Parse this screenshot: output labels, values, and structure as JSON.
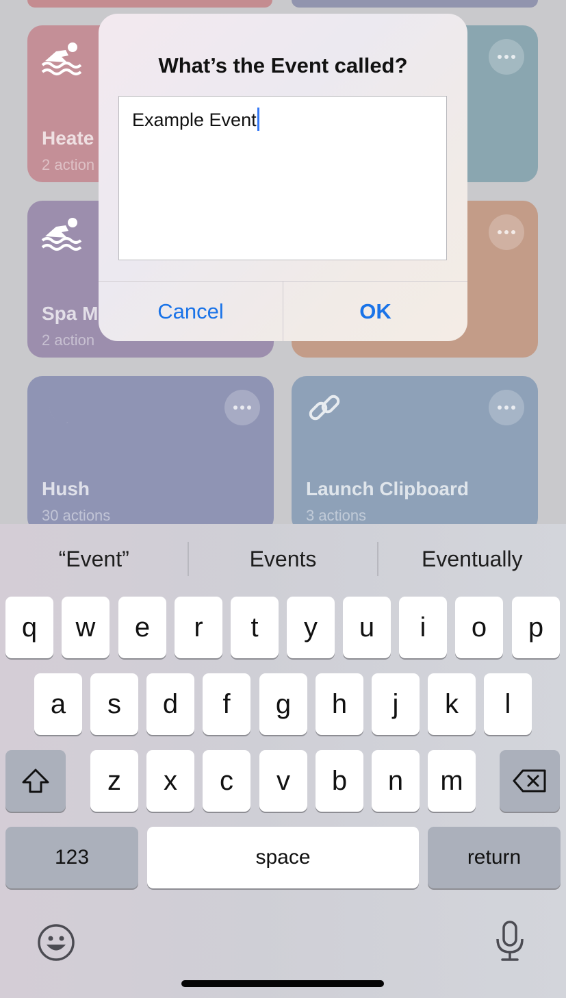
{
  "background_cards": [
    {
      "title": "Heate",
      "subtitle": "2 action",
      "color": "#c48f97",
      "icon": "swimmer-icon"
    },
    {
      "title": "",
      "subtitle": "",
      "color": "#8aa6b0",
      "icon": ""
    },
    {
      "title": "Spa M",
      "subtitle": "2 action",
      "color": "#9c8ead",
      "icon": "swimmer-icon"
    },
    {
      "title": "",
      "subtitle": "",
      "color": "#c39c88",
      "icon": ""
    },
    {
      "title": "Hush",
      "subtitle": "30 actions",
      "color": "#8f94b4",
      "icon": "moon-icon"
    },
    {
      "title": "Launch Clipboard",
      "subtitle": "3 actions",
      "color": "#8ea1b8",
      "icon": "link-icon"
    }
  ],
  "alert": {
    "title": "What’s the Event called?",
    "input_value": "Example Event",
    "cancel_label": "Cancel",
    "ok_label": "OK"
  },
  "keyboard": {
    "suggestions": [
      "“Event”",
      "Events",
      "Eventually"
    ],
    "row1": [
      "q",
      "w",
      "e",
      "r",
      "t",
      "y",
      "u",
      "i",
      "o",
      "p"
    ],
    "row2": [
      "a",
      "s",
      "d",
      "f",
      "g",
      "h",
      "j",
      "k",
      "l"
    ],
    "row3": [
      "z",
      "x",
      "c",
      "v",
      "b",
      "n",
      "m"
    ],
    "numbers_label": "123",
    "space_label": "space",
    "return_label": "return",
    "icons": {
      "shift": "shift-icon",
      "delete": "delete-icon",
      "emoji": "emoji-icon",
      "dictation": "microphone-icon"
    }
  },
  "colors": {
    "accent": "#1a73e8",
    "caret": "#3478f6"
  }
}
